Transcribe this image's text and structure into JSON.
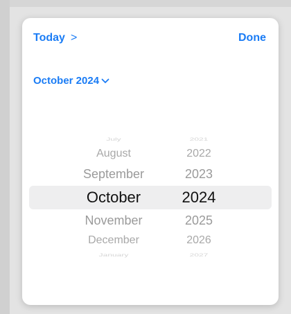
{
  "header": {
    "today_label": "Today",
    "today_chevron": ">",
    "done_label": "Done"
  },
  "month_selector": {
    "label": "October 2024"
  },
  "picker": {
    "months": {
      "faded_top": "July",
      "above_2": "August",
      "above_1": "September",
      "selected": "October",
      "below_1": "November",
      "below_2": "December",
      "faded_bottom": "January"
    },
    "years": {
      "faded_top": "2021",
      "above_2": "2022",
      "above_1": "2023",
      "selected": "2024",
      "below_1": "2025",
      "below_2": "2026",
      "faded_bottom": "2027"
    }
  },
  "colors": {
    "accent": "#1a7cf5",
    "selection_band": "#eeeeef"
  }
}
